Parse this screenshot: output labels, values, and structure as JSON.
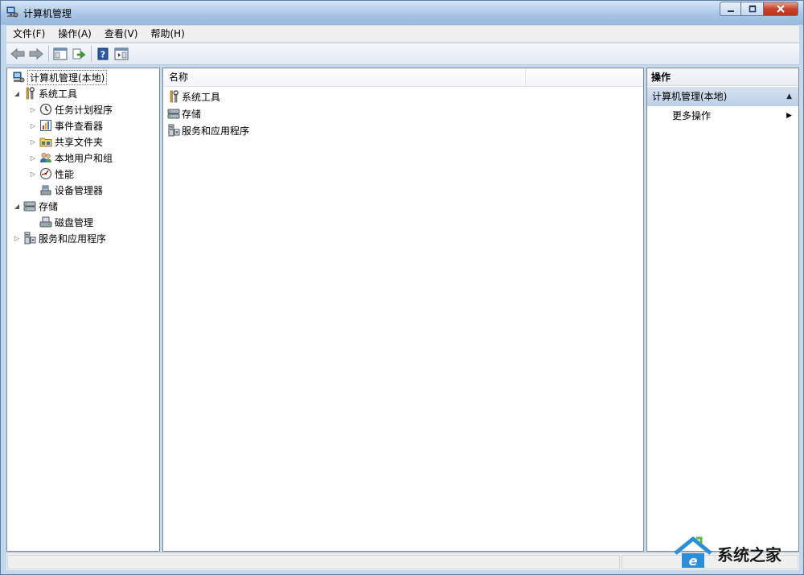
{
  "window": {
    "title": "计算机管理"
  },
  "menubar": {
    "items": [
      "文件(F)",
      "操作(A)",
      "查看(V)",
      "帮助(H)"
    ]
  },
  "toolbar": {
    "buttons": [
      "back-arrow-icon",
      "forward-arrow-icon",
      "show-hide-tree-icon",
      "export-list-icon",
      "help-icon",
      "show-hide-action-pane-icon"
    ]
  },
  "tree": {
    "root": "计算机管理(本地)",
    "system_tools": "系统工具",
    "task_scheduler": "任务计划程序",
    "event_viewer": "事件查看器",
    "shared_folders": "共享文件夹",
    "local_users": "本地用户和组",
    "performance": "性能",
    "device_manager": "设备管理器",
    "storage": "存储",
    "disk_management": "磁盘管理",
    "services_apps": "服务和应用程序"
  },
  "list": {
    "column_name": "名称",
    "rows": [
      "系统工具",
      "存储",
      "服务和应用程序"
    ]
  },
  "actions": {
    "title": "操作",
    "section": "计算机管理(本地)",
    "more": "更多操作"
  },
  "watermark": {
    "text": "系统之家"
  },
  "colors": {
    "titlebar": "#a6c3e4",
    "close_button": "#c7432b",
    "action_section": "#bccfe6"
  }
}
